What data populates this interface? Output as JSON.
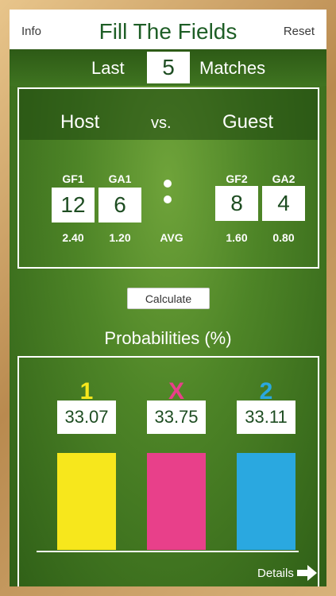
{
  "header": {
    "title": "Fill The Fields",
    "info_label": "Info",
    "reset_label": "Reset"
  },
  "matches": {
    "prefix": "Last",
    "count": "5",
    "suffix": "Matches"
  },
  "teams": {
    "host": "Host",
    "vs": "vs.",
    "guest": "Guest"
  },
  "stats": {
    "gf1": {
      "label": "GF1",
      "value": "12",
      "avg": "2.40"
    },
    "ga1": {
      "label": "GA1",
      "value": "6",
      "avg": "1.20"
    },
    "gf2": {
      "label": "GF2",
      "value": "8",
      "avg": "1.60"
    },
    "ga2": {
      "label": "GA2",
      "value": "4",
      "avg": "0.80"
    },
    "avg_label": "AVG"
  },
  "calculate_label": "Calculate",
  "probabilities": {
    "title": "Probabilities (%)",
    "outcomes": [
      {
        "label": "1",
        "value": "33.07",
        "color": "#f7e71c"
      },
      {
        "label": "X",
        "value": "33.75",
        "color": "#e8408a"
      },
      {
        "label": "2",
        "value": "33.11",
        "color": "#2aa8e0"
      }
    ]
  },
  "details_label": "Details",
  "icons": {
    "details_arrow": "arrow-right-icon"
  }
}
